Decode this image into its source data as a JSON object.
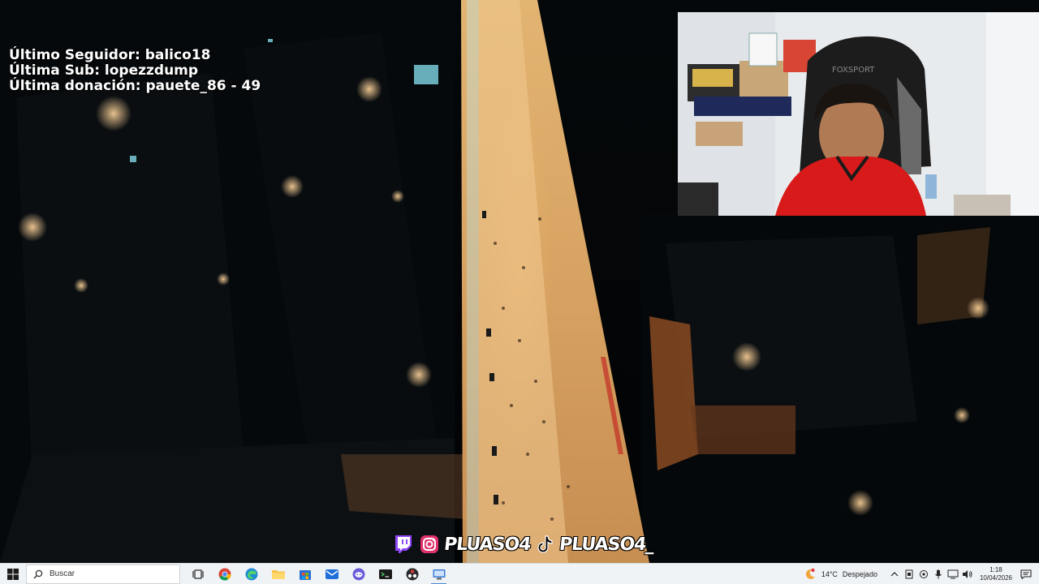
{
  "alerts": {
    "last_follower": "Último Seguidor: balico18",
    "last_sub": "Última Sub: lopezzdump",
    "last_donation": "Última donación: pauete_86 - 49"
  },
  "socials": {
    "icons": [
      "twitch-icon",
      "instagram-icon",
      "tiktok-icon"
    ],
    "instagram_handle": "PLUASO4",
    "tiktok_handle": "PLUASO4_"
  },
  "taskbar": {
    "search_placeholder": "Buscar",
    "pinned_apps": [
      "task-view-icon",
      "chrome-icon",
      "edge-icon",
      "file-explorer-icon",
      "store-icon",
      "mail-icon",
      "discord-icon",
      "terminal-icon",
      "obs-icon",
      "remote-desktop-icon"
    ],
    "active_app": "remote-desktop-icon",
    "weather_temp": "14°C",
    "weather_desc": "Despejado",
    "time": "1:18",
    "date": "10/04/2026"
  },
  "colors": {
    "taskbar_bg": "#f0f3f6",
    "twitch": "#9146ff",
    "instagram": "#e1306c",
    "accent": "#4a8ad6"
  }
}
